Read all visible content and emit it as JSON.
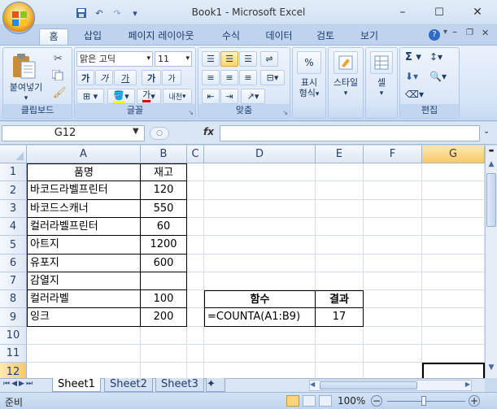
{
  "window": {
    "title": "Book1 - Microsoft Excel",
    "minimize": "–",
    "maximize": "☐",
    "close": "✕"
  },
  "qat": {
    "save": "▪",
    "undo": "↶",
    "redo": "↷",
    "more": "▾"
  },
  "tabs": [
    "홈",
    "삽입",
    "페이지 레이아웃",
    "수식",
    "데이터",
    "검토",
    "보기"
  ],
  "ribbon": {
    "clipboard": {
      "label": "클립보드",
      "paste": "붙여넣기"
    },
    "font": {
      "label": "글꼴",
      "name": "맑은 고딕",
      "size": "11",
      "bold": "가",
      "italic": "가",
      "underline": "가",
      "grow": "가",
      "shrink": "가",
      "fontcolor": "가",
      "phonetic": "내천"
    },
    "align": {
      "label": "맞춤"
    },
    "number": {
      "label": "표시\n형식",
      "display": "표시",
      "format": "형식"
    },
    "style": {
      "label": "스타일"
    },
    "cells": {
      "label": "셀"
    },
    "edit": {
      "label": "편집"
    }
  },
  "formulabar": {
    "namebox": "G12",
    "fx": "fx",
    "formula": ""
  },
  "columns": [
    "A",
    "B",
    "C",
    "D",
    "E",
    "F",
    "G"
  ],
  "rows": [
    "1",
    "2",
    "3",
    "4",
    "5",
    "6",
    "7",
    "8",
    "9",
    "10",
    "11",
    "12"
  ],
  "cells": {
    "A1": "품명",
    "B1": "재고",
    "A2": "바코드라벨프린터",
    "B2": "120",
    "A3": "바코드스캐너",
    "B3": "550",
    "A4": "컬러라벨프린터",
    "B4": "60",
    "A5": "아트지",
    "B5": "1200",
    "A6": "유포지",
    "B6": "600",
    "A7": "감열지",
    "B7": "",
    "A8": "컬러라벨",
    "B8": "100",
    "A9": "잉크",
    "B9": "200",
    "D8": "함수",
    "E8": "결과",
    "D9": "=COUNTA(A1:B9)",
    "E9": "17"
  },
  "sheets": [
    "Sheet1",
    "Sheet2",
    "Sheet3"
  ],
  "status": {
    "ready": "준비",
    "zoom": "100%"
  }
}
